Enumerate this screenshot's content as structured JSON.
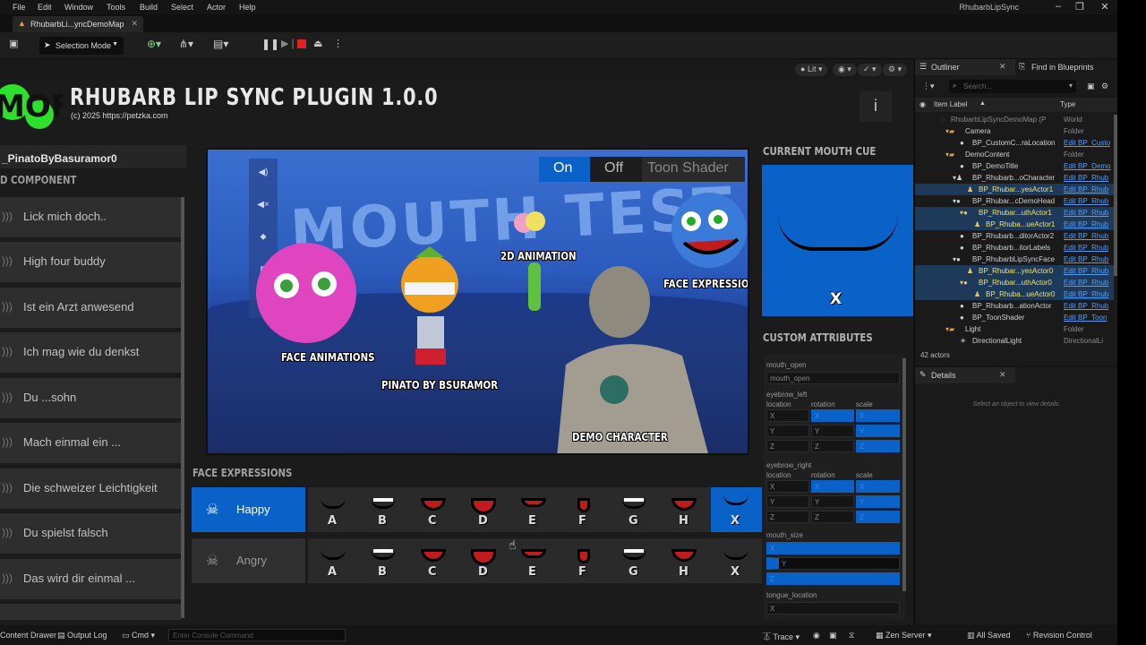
{
  "menu": {
    "items": [
      "File",
      "Edit",
      "Window",
      "Tools",
      "Build",
      "Select",
      "Actor",
      "Help"
    ],
    "window_title": "RhubarbLipSync",
    "map_tab": "RhubarbLi...yncDemoMap"
  },
  "toolbar": {
    "selection_mode": "Selection Mode"
  },
  "viewport": {
    "lit_label": "Lit",
    "plugin_title": "RHUBARB LIP SYNC PLUGIN 1.0.0",
    "copyright": "(c) 2025 https://petzka.com",
    "logo_text": "MOFX",
    "info_label": "i",
    "actor_name": "_PinatoByBasuramor0",
    "component_header": "D COMPONENT",
    "phrases": [
      "Lick mich doch..",
      "High four buddy",
      "Ist ein Arzt anwesend",
      "Ich mag wie du denkst",
      "Du ...sohn",
      "Mach einmal ein ...",
      "Die schweizer Leichtigkeit",
      "Du spielst falsch",
      "Das wird dir einmal ..."
    ],
    "scene": {
      "toggle_on": "On",
      "toggle_off": "Off",
      "toggle_toon": "Toon Shader",
      "backdrop_text": "MOUTH TEST",
      "labels": {
        "face_animations": "FACE ANIMATIONS",
        "pinato": "PINATO BY BSURAMOR",
        "animation_2d": "2D ANIMATION",
        "face_expression": "FACE EXPRESSION",
        "demo_character": "DEMO CHARACTER"
      }
    },
    "face_expressions": {
      "header": "FACE EXPRESSIONS",
      "rows": [
        {
          "label": "Happy",
          "active": true
        },
        {
          "label": "Angry",
          "active": false
        }
      ],
      "cues": [
        "A",
        "B",
        "C",
        "D",
        "E",
        "F",
        "G",
        "H",
        "X"
      ],
      "selected_cue": "X"
    },
    "current_mouth_cue": {
      "header": "CURRENT MOUTH CUE",
      "value": "X"
    },
    "custom_attributes": {
      "header": "CUSTOM ATTRIBUTES",
      "mouth_open_label": "mouth_open",
      "mouth_open_value": "mouth_open",
      "eyebrow_left": "eyebrow_left",
      "eyebrow_right": "eyebrow_right",
      "col_location": "location",
      "col_rotation": "rotation",
      "col_scale": "scale",
      "axis_x": "X",
      "axis_y": "Y",
      "axis_z": "Z",
      "mouth_size": "mouth_size",
      "tongue_location": "tongue_location"
    }
  },
  "outliner": {
    "tab": "Outliner",
    "find_tab": "Find in Blueprints",
    "search_placeholder": "Search...",
    "col_label": "Item Label",
    "col_type": "Type",
    "rows": [
      {
        "name": "RhubarbLipSyncDemoMap (P",
        "type": "World",
        "link": false
      },
      {
        "name": "Camera",
        "type": "Folder",
        "link": false
      },
      {
        "name": "BP_CustomC...raLocation",
        "type": "Edit BP_Custo",
        "link": true
      },
      {
        "name": "DemoContent",
        "type": "Folder",
        "link": false
      },
      {
        "name": "BP_DemoTitle",
        "type": "Edit BP_Demo",
        "link": true
      },
      {
        "name": "BP_Rhubarb...oCharacter",
        "type": "Edit BP_Rhub",
        "link": true
      },
      {
        "name": "BP_Rhubar...yesActor1",
        "type": "Edit BP_Rhub",
        "link": true
      },
      {
        "name": "BP_Rhubar...cDemoHead",
        "type": "Edit BP_Rhub",
        "link": true
      },
      {
        "name": "BP_Rhubar...uthActor1",
        "type": "Edit BP_Rhub",
        "link": true
      },
      {
        "name": "BP_Rhuba...ueActor1",
        "type": "Edit BP_Rhub",
        "link": true
      },
      {
        "name": "BP_Rhubarb...ditorActor2",
        "type": "Edit BP_Rhub",
        "link": true
      },
      {
        "name": "BP_Rhubarb...itorLabels",
        "type": "Edit BP_Rhub",
        "link": true
      },
      {
        "name": "BP_RhubarbLipSyncFace",
        "type": "Edit BP_Rhub",
        "link": true
      },
      {
        "name": "BP_Rhubar...yesActor0",
        "type": "Edit BP_Rhub",
        "link": true
      },
      {
        "name": "BP_Rhubar...uthActor0",
        "type": "Edit BP_Rhub",
        "link": true
      },
      {
        "name": "BP_Rhuba...ueActor0",
        "type": "Edit BP_Rhub",
        "link": true
      },
      {
        "name": "BP_Rhubarb...ationActor",
        "type": "Edit BP_Rhub",
        "link": true
      },
      {
        "name": "BP_ToonShader",
        "type": "Edit BP_Toon",
        "link": true
      },
      {
        "name": "Light",
        "type": "Folder",
        "link": false
      },
      {
        "name": "DirectionalLight",
        "type": "DirectionalLi",
        "link": false
      }
    ],
    "actor_count": "42 actors"
  },
  "details": {
    "tab": "Details",
    "empty_message": "Select an object to view details."
  },
  "statusbar": {
    "content_drawer": "Content Drawer",
    "output_log": "Output Log",
    "cmd": "Cmd",
    "console_placeholder": "Enter Console Command",
    "trace": "Trace",
    "zen_server": "Zen Server",
    "all_saved": "All Saved",
    "revision_control": "Revision Control"
  },
  "colors": {
    "accent_blue": "#0a62c8",
    "link_blue": "#5b9cf0",
    "logo_green": "#2ee02e"
  }
}
